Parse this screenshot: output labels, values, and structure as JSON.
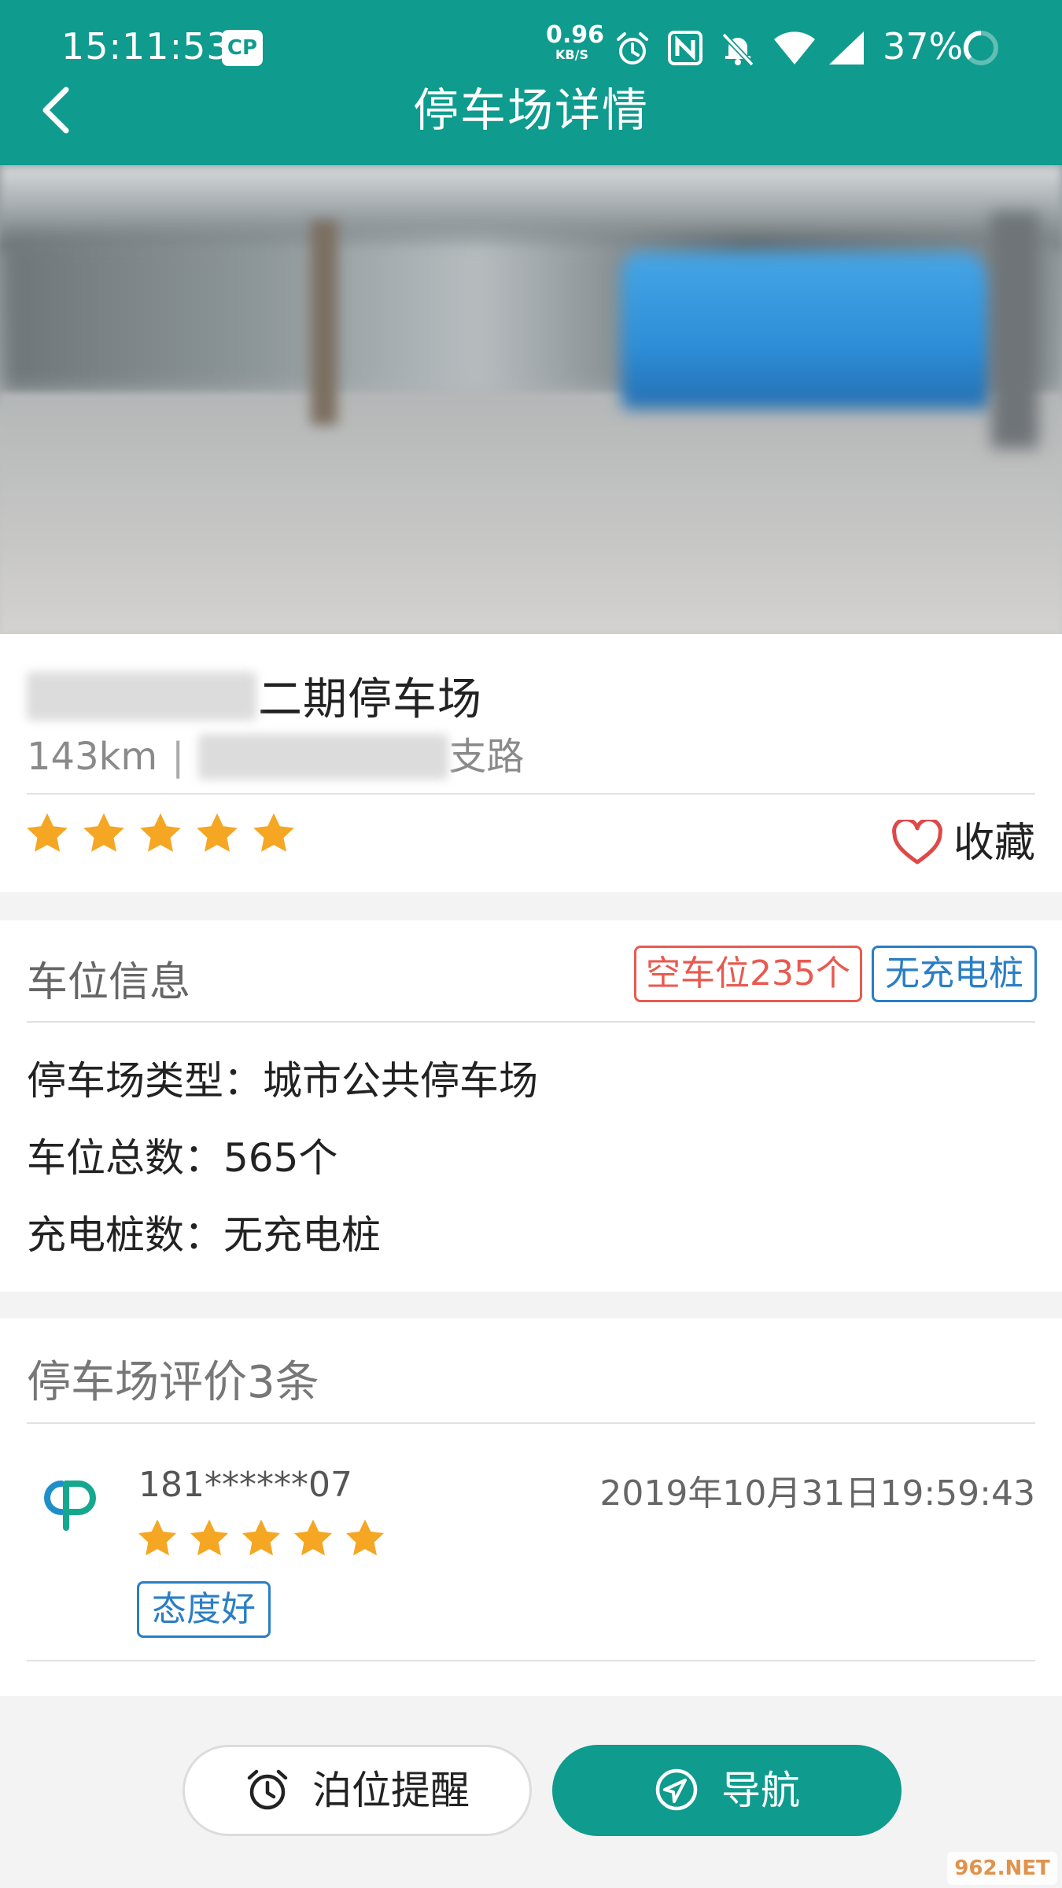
{
  "status_bar": {
    "time": "15:11:53",
    "app_badge": "CP",
    "net_speed_value": "0.96",
    "net_speed_unit": "KB/S",
    "battery_percent": "37%",
    "icons": [
      "alarm-icon",
      "nfc-icon",
      "mute-icon",
      "wifi-icon",
      "signal-icon",
      "battery-icon"
    ]
  },
  "header": {
    "title": "停车场详情",
    "background_color": "#0f9b8e"
  },
  "lot": {
    "name_suffix": "二期停车场",
    "distance": "143km",
    "separator": "|",
    "address_suffix": "支路",
    "rating": 5,
    "favorite_label": "收藏"
  },
  "space_info": {
    "title": "车位信息",
    "free_badge": "空车位235个",
    "charging_badge": "无充电桩",
    "lines": [
      "停车场类型：城市公共停车场",
      "车位总数：565个",
      "充电桩数：无充电桩"
    ]
  },
  "reviews": {
    "title": "停车场评价3条",
    "items": [
      {
        "user": "181******07",
        "date": "2019年10月31日19:59:43",
        "rating": 5,
        "tag": "态度好"
      }
    ]
  },
  "actions": {
    "remind_label": "泊位提醒",
    "navigate_label": "导航"
  },
  "watermark": "962.NET",
  "colors": {
    "accent": "#0f9b8e",
    "star": "#f5a623",
    "free_badge": "#e85a50",
    "info_badge": "#2a7ec4",
    "favorite_heart": "#e04848"
  }
}
